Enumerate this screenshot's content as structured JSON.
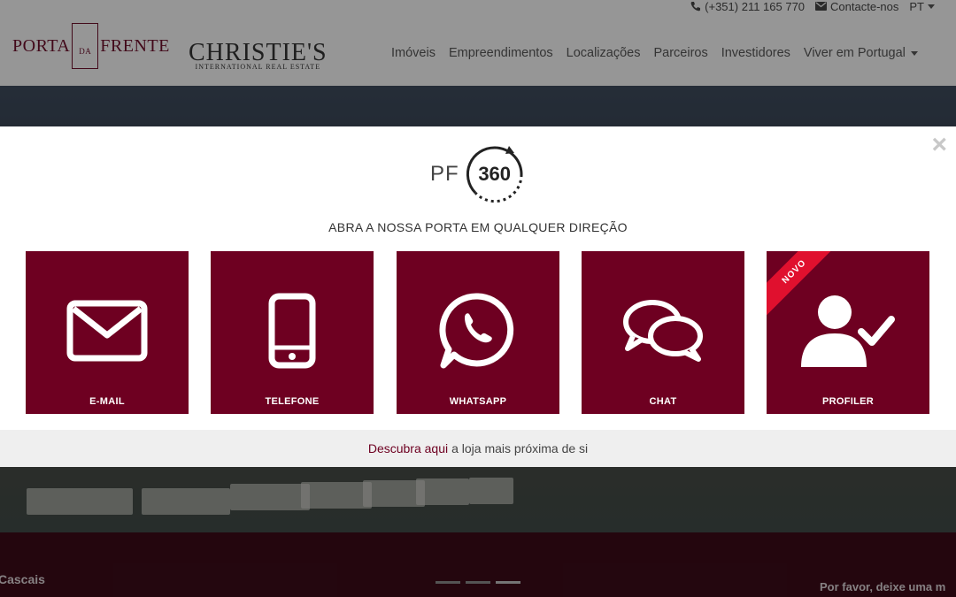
{
  "header": {
    "phone": "(+351) 211 165 770",
    "contact": "Contacte-nos",
    "lang": "PT",
    "logo_main_left": "PORTA",
    "logo_main_mid": "DA",
    "logo_main_right": "FRENTE",
    "logo_partner": "CHRISTIE'S",
    "logo_partner_sub": "INTERNATIONAL REAL ESTATE",
    "nav": [
      "Imóveis",
      "Empreendimentos",
      "Localizações",
      "Parceiros",
      "Investidores",
      "Viver em Portugal"
    ]
  },
  "background": {
    "band_left": "Cascais",
    "band_right": "Por favor, deixe uma m"
  },
  "modal": {
    "pf_text": "PF",
    "pf_number": "360",
    "tagline": "ABRA A NOSSA PORTA EM QUALQUER DIREÇÃO",
    "close_glyph": "×",
    "tiles": [
      {
        "label": "E-MAIL",
        "icon": "envelope-icon"
      },
      {
        "label": "TELEFONE",
        "icon": "phone-icon"
      },
      {
        "label": "WHATSAPP",
        "icon": "whatsapp-icon"
      },
      {
        "label": "CHAT",
        "icon": "chat-icon"
      },
      {
        "label": "PROFILER",
        "icon": "profile-check-icon",
        "badge": "NOVO"
      }
    ],
    "footer_link": "Descubra aqui",
    "footer_text": "a loja mais próxima de si"
  },
  "colors": {
    "brand": "#6e0021",
    "ribbon": "#e0102e"
  }
}
